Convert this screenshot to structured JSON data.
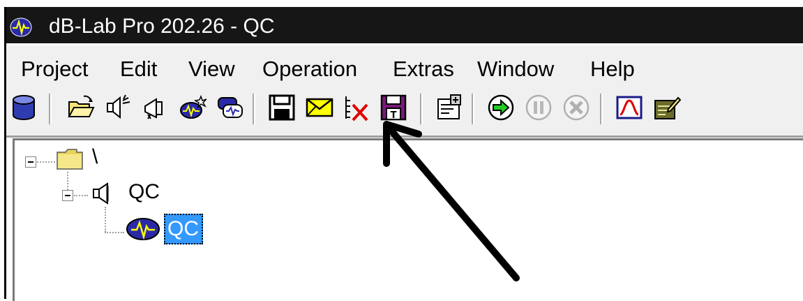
{
  "window": {
    "title": "dB-Lab Pro 202.26 - QC"
  },
  "menu": {
    "items": [
      "Project",
      "Edit",
      "View",
      "Operation",
      "Extras",
      "Window",
      "Help"
    ]
  },
  "toolbar": {
    "icons": [
      "database-icon",
      "open-folder-icon",
      "speaker-cable-icon",
      "speaker-icon",
      "new-measurement-icon",
      "measurement-switch-icon",
      "save-icon",
      "email-icon",
      "delete-list-icon",
      "save-template-icon",
      "properties-icon",
      "run-icon",
      "pause-icon",
      "stop-icon",
      "graph-icon",
      "edit-icon"
    ]
  },
  "tree": {
    "root_label": "\\",
    "child_label": "QC",
    "leaf_label": "QC"
  },
  "colors": {
    "titlebar": "#161616",
    "selection": "#3399ff",
    "arrow": "#000000"
  }
}
